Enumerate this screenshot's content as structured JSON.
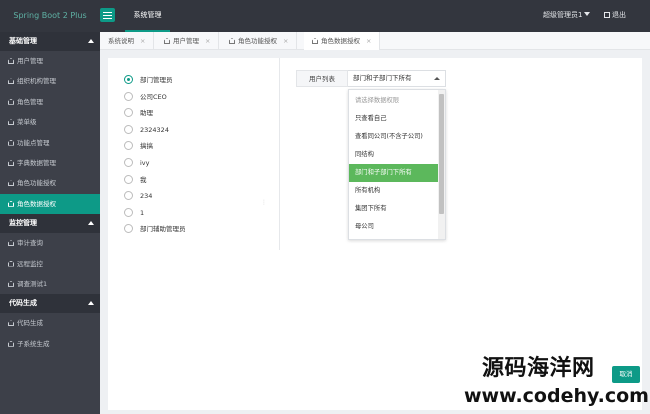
{
  "app": {
    "brand": "Spring Boot 2 Plus",
    "top_tab": "系统管理",
    "user": "超级管理员1",
    "logout": "退出"
  },
  "sidebar": {
    "groups": [
      {
        "label": "基础管理",
        "items": [
          "用户管理",
          "组织机构管理",
          "角色管理",
          "菜单级",
          "功能点管理",
          "字典数据管理",
          "角色功能授权",
          "角色数据授权"
        ]
      },
      {
        "label": "监控管理",
        "items": [
          "审计查询",
          "远程监控",
          "调查测试1"
        ]
      },
      {
        "label": "代码生成",
        "items": [
          "代码生成",
          "子系统生成"
        ]
      }
    ],
    "active_item": "角色数据授权"
  },
  "tabs": [
    {
      "label": "系统说明",
      "close": "×"
    },
    {
      "label": "用户管理",
      "close": "×"
    },
    {
      "label": "角色功能授权",
      "close": "×"
    },
    {
      "label": "角色数据授权",
      "close": "×"
    }
  ],
  "roles": [
    "部门管理员",
    "公司CEO",
    "助理",
    "2324324",
    "搞搞",
    "ivy",
    "我",
    "234",
    "1",
    "部门辅助管理员"
  ],
  "selected_role": "部门管理员",
  "field": {
    "label": "用户列表",
    "value": "部门和子部门下所有"
  },
  "dropdown": {
    "placeholder": "请选择数据权限",
    "options": [
      "只查看自己",
      "查看同公司(不含子公司)",
      "同结构",
      "部门和子部门下所有",
      "所有机构",
      "集团下所有",
      "母公司"
    ],
    "selected": "部门和子部门下所有"
  },
  "buttons": {
    "cancel": "取消"
  },
  "watermark": {
    "line1": "源码海洋网",
    "line2": "www.codehy.com"
  },
  "colors": {
    "accent": "#0d9a87",
    "selected_option": "#5cb85c",
    "sidebar_bg": "#3d4049",
    "topbar_bg": "#33363e"
  }
}
